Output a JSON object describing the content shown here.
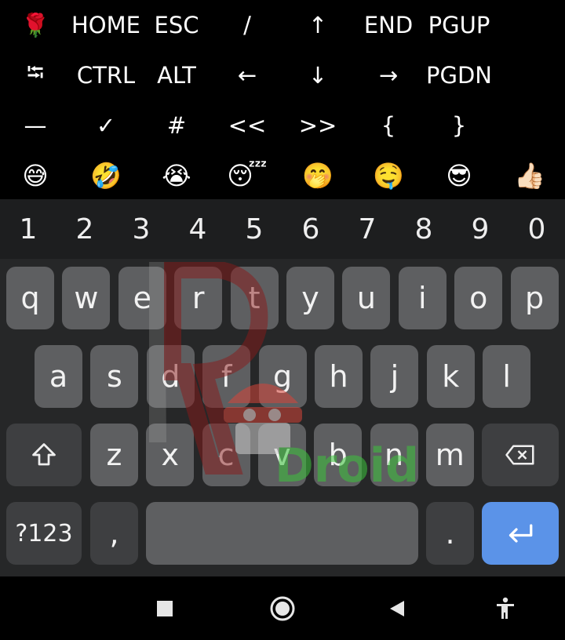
{
  "extra_keys": {
    "row1": [
      {
        "label": "🌹",
        "name": "rose-emoji-key"
      },
      {
        "label": "HOME",
        "name": "home-key"
      },
      {
        "label": "ESC",
        "name": "esc-key"
      },
      {
        "label": "/",
        "name": "slash-key"
      },
      {
        "label": "↑",
        "name": "arrow-up-key"
      },
      {
        "label": "END",
        "name": "end-key"
      },
      {
        "label": "PGUP",
        "name": "pgup-key"
      },
      {
        "label": "",
        "name": "empty-key"
      }
    ],
    "row2": [
      {
        "label": "⭾",
        "name": "tab-key"
      },
      {
        "label": "CTRL",
        "name": "ctrl-key"
      },
      {
        "label": "ALT",
        "name": "alt-key"
      },
      {
        "label": "←",
        "name": "arrow-left-key"
      },
      {
        "label": "↓",
        "name": "arrow-down-key"
      },
      {
        "label": "→",
        "name": "arrow-right-key"
      },
      {
        "label": "PGDN",
        "name": "pgdn-key"
      },
      {
        "label": "",
        "name": "empty-key"
      }
    ],
    "row3": [
      {
        "label": "—",
        "name": "dash-key"
      },
      {
        "label": "✓",
        "name": "checkmark-key"
      },
      {
        "label": "#",
        "name": "hash-key"
      },
      {
        "label": "<<",
        "name": "double-left-key"
      },
      {
        "label": ">>",
        "name": "double-right-key"
      },
      {
        "label": "{",
        "name": "left-brace-key"
      },
      {
        "label": "}",
        "name": "right-brace-key"
      },
      {
        "label": "",
        "name": "empty-key"
      }
    ],
    "row4": [
      {
        "label": "😅",
        "name": "sweat-smile-emoji-key"
      },
      {
        "label": "🤣",
        "name": "rofl-emoji-key"
      },
      {
        "label": "😭",
        "name": "crying-emoji-key"
      },
      {
        "label": "😴",
        "name": "sleeping-emoji-key"
      },
      {
        "label": "🤭",
        "name": "hand-over-mouth-emoji-key"
      },
      {
        "label": "🤤",
        "name": "drooling-emoji-key"
      },
      {
        "label": "😎",
        "name": "sunglasses-emoji-key"
      },
      {
        "label": "👍🏻",
        "name": "thumbs-up-emoji-key"
      }
    ]
  },
  "keyboard": {
    "numbers": [
      "1",
      "2",
      "3",
      "4",
      "5",
      "6",
      "7",
      "8",
      "9",
      "0"
    ],
    "row1": [
      "q",
      "w",
      "e",
      "r",
      "t",
      "y",
      "u",
      "i",
      "o",
      "p"
    ],
    "row2": [
      "a",
      "s",
      "d",
      "f",
      "g",
      "h",
      "j",
      "k",
      "l"
    ],
    "row3": [
      "z",
      "x",
      "c",
      "v",
      "b",
      "n",
      "m"
    ],
    "symbols_label": "?123",
    "comma_label": ",",
    "period_label": ".",
    "watermark_text": "Droid",
    "colors": {
      "key": "#5e5f61",
      "special_key": "#3e3f41",
      "enter_key": "#5b93e8",
      "background": "#262728"
    }
  },
  "icons": {
    "shift": "shift-icon",
    "backspace": "backspace-icon",
    "enter": "enter-icon",
    "nav_recents": "square-icon",
    "nav_home": "circle-icon",
    "nav_back": "triangle-icon",
    "nav_accessibility": "accessibility-icon"
  }
}
